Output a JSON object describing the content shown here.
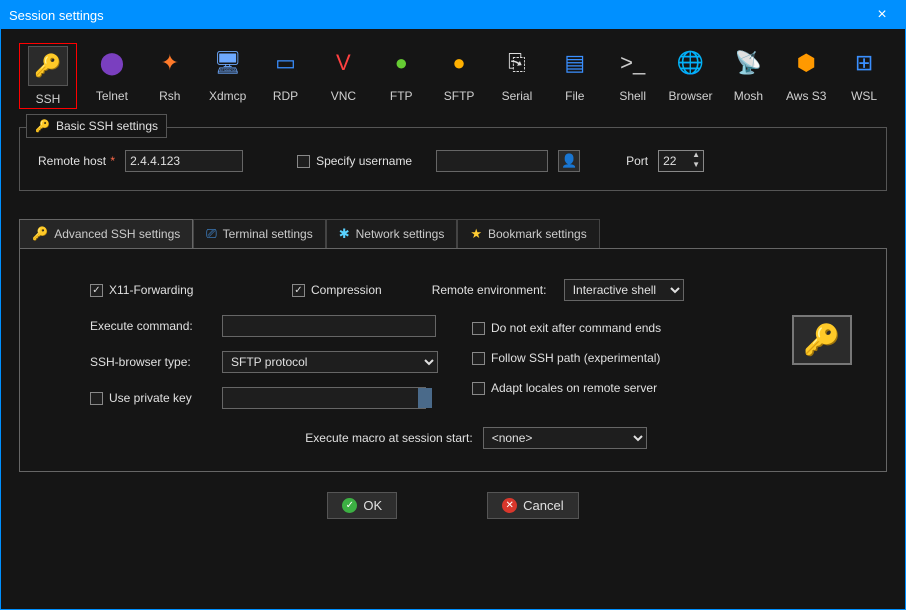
{
  "window": {
    "title": "Session settings"
  },
  "session_types": [
    {
      "label": "SSH",
      "icon": "🔑",
      "selected": true,
      "color": "#ffd24a"
    },
    {
      "label": "Telnet",
      "icon": "⬤",
      "color": "#7a3fbf"
    },
    {
      "label": "Rsh",
      "icon": "✦",
      "color": "#ff7a2a"
    },
    {
      "label": "Xdmcp",
      "icon": "🖥",
      "color": "#6da9ff"
    },
    {
      "label": "RDP",
      "icon": "▭",
      "color": "#3a8fff"
    },
    {
      "label": "VNC",
      "icon": "V",
      "color": "#ff4040"
    },
    {
      "label": "FTP",
      "icon": "●",
      "color": "#66cc33"
    },
    {
      "label": "SFTP",
      "icon": "●",
      "color": "#ffb000"
    },
    {
      "label": "Serial",
      "icon": "⎘",
      "color": "#dddddd"
    },
    {
      "label": "File",
      "icon": "▤",
      "color": "#3a8fff"
    },
    {
      "label": "Shell",
      "icon": ">_",
      "color": "#cccccc"
    },
    {
      "label": "Browser",
      "icon": "🌐",
      "color": "#33aaff"
    },
    {
      "label": "Mosh",
      "icon": "📡",
      "color": "#888888"
    },
    {
      "label": "Aws S3",
      "icon": "⬢",
      "color": "#ff9900"
    },
    {
      "label": "WSL",
      "icon": "⊞",
      "color": "#3a8fff"
    }
  ],
  "basic": {
    "legend": "Basic SSH settings",
    "host_label": "Remote host",
    "host_value": "2.4.4.123",
    "specify_user_label": "Specify username",
    "specify_user_checked": false,
    "username_value": "",
    "port_label": "Port",
    "port_value": "22"
  },
  "tabs": [
    {
      "label": "Advanced SSH settings",
      "icon": "🔑",
      "icon_color": "#ffd24a"
    },
    {
      "label": "Terminal settings",
      "icon": "⎚",
      "icon_color": "#4aa3ff"
    },
    {
      "label": "Network settings",
      "icon": "✱",
      "icon_color": "#5ad2ff"
    },
    {
      "label": "Bookmark settings",
      "icon": "★",
      "icon_color": "#ffcc33"
    }
  ],
  "advanced": {
    "x11_label": "X11-Forwarding",
    "x11_checked": true,
    "compression_label": "Compression",
    "compression_checked": true,
    "remote_env_label": "Remote environment:",
    "remote_env_value": "Interactive shell",
    "exec_cmd_label": "Execute command:",
    "exec_cmd_value": "",
    "no_exit_label": "Do not exit after command ends",
    "no_exit_checked": false,
    "ssh_browser_label": "SSH-browser type:",
    "ssh_browser_value": "SFTP protocol",
    "follow_path_label": "Follow SSH path (experimental)",
    "follow_path_checked": false,
    "private_key_label": "Use private key",
    "private_key_checked": false,
    "private_key_value": "",
    "adapt_locales_label": "Adapt locales on remote server",
    "adapt_locales_checked": false,
    "macro_label": "Execute macro at session start:",
    "macro_value": "<none>"
  },
  "buttons": {
    "ok": "OK",
    "cancel": "Cancel"
  }
}
